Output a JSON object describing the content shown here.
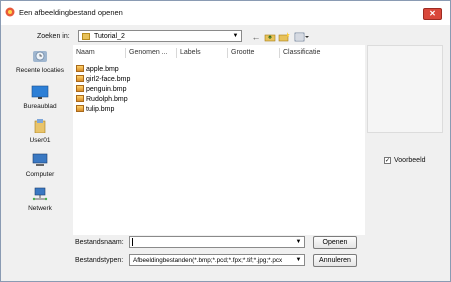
{
  "window": {
    "title": "Een afbeeldingbestand openen",
    "close_glyph": "✕"
  },
  "toolbar": {
    "look_in_label": "Zoeken in:",
    "look_in_value": "Tutorial_2",
    "back_icon": "←",
    "up_icon": "📁",
    "new_folder_icon": "✱",
    "views_icon": "▦▾"
  },
  "places": [
    {
      "label": "Recente locaties",
      "icon": "recent-locations-icon"
    },
    {
      "label": "Bureaublad",
      "icon": "desktop-icon"
    },
    {
      "label": "User01",
      "icon": "user-folder-icon"
    },
    {
      "label": "Computer",
      "icon": "computer-icon"
    },
    {
      "label": "Netwerk",
      "icon": "network-icon"
    }
  ],
  "columns": [
    "Naam",
    "Genomen ...",
    "Labels",
    "Grootte",
    "Classificatie"
  ],
  "files": [
    "apple.bmp",
    "girl2-face.bmp",
    "penguin.bmp",
    "Rudolph.bmp",
    "tulip.bmp"
  ],
  "preview": {
    "checkbox_label": "Voorbeeld",
    "checked": true
  },
  "footer": {
    "filename_label": "Bestandsnaam:",
    "filename_value": "",
    "filetype_label": "Bestandstypen:",
    "filetype_value": "Afbeeldingbestanden(*.bmp;*.pcd;*.fpx;*.tif;*.jpg;*.pcx",
    "open_button": "Openen",
    "cancel_button": "Annuleren"
  },
  "colors": {
    "accent": "#d9483b",
    "folder": "#e8c25a"
  }
}
